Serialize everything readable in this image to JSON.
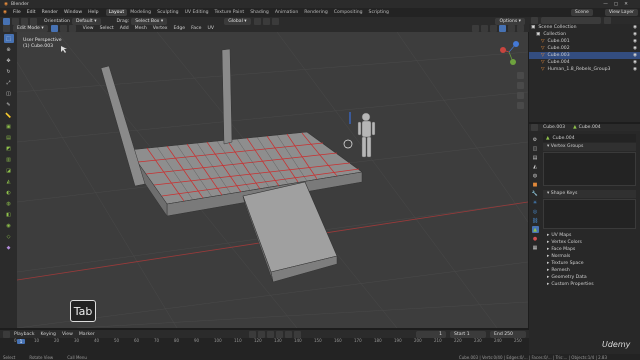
{
  "titlebar": {
    "app_title": "Blender"
  },
  "menu": [
    "File",
    "Edit",
    "Render",
    "Window",
    "Help"
  ],
  "workspaces": [
    "Layout",
    "Modeling",
    "Sculpting",
    "UV Editing",
    "Texture Paint",
    "Shading",
    "Animation",
    "Rendering",
    "Compositing",
    "Scripting"
  ],
  "active_workspace": "Layout",
  "scene": {
    "scene_label": "Scene",
    "view_layer_label": "View Layer"
  },
  "header": {
    "orientation_label": "Orientation",
    "orientation_value": "Global",
    "default_label": "Default",
    "drag_label": "Drag:",
    "drag_value": "Select Box",
    "global_label": "Global",
    "options_label": "Options",
    "mode": "Edit Mode",
    "menus": [
      "View",
      "Select",
      "Add",
      "Mesh",
      "Vertex",
      "Edge",
      "Face",
      "UV"
    ]
  },
  "viewport": {
    "view_name": "User Perspective",
    "object_name": "(1) Cube.003",
    "key_overlay": "Tab"
  },
  "outliner": {
    "rows": [
      "Scene Collection",
      "Collection",
      "Cube.001",
      "Cube.002",
      "Cube.003",
      "Cube.004",
      "Human_1.8_Rebels_Group3"
    ],
    "selected": "Cube.003"
  },
  "properties": {
    "object_name": "Cube.003",
    "data_name": "Cube.004",
    "mesh_field": "Cube.004",
    "sections": [
      "Vertex Groups",
      "Shape Keys",
      "UV Maps",
      "Vertex Colors",
      "Face Maps",
      "Normals",
      "Texture Space",
      "Remesh",
      "Geometry Data",
      "Custom Properties"
    ]
  },
  "timeline": {
    "menus": [
      "Playback",
      "Keying",
      "View",
      "Marker"
    ],
    "current_frame": "1",
    "start_label": "Start",
    "start_value": "1",
    "end_label": "End",
    "end_value": "250",
    "ticks": [
      "0",
      "10",
      "20",
      "30",
      "40",
      "50",
      "60",
      "70",
      "80",
      "90",
      "100",
      "110",
      "120",
      "130",
      "140",
      "150",
      "160",
      "170",
      "180",
      "190",
      "200",
      "210",
      "220",
      "230",
      "240",
      "250"
    ]
  },
  "statusbar": {
    "items": [
      "Select",
      "Rotate View",
      "Call Menu"
    ],
    "version": "Cube.003 | Verts:0/40 | Edges:0/... | Faces:0/... | Tris:... | Objects:1/4 | 2.83"
  },
  "watermark": "Udemy"
}
